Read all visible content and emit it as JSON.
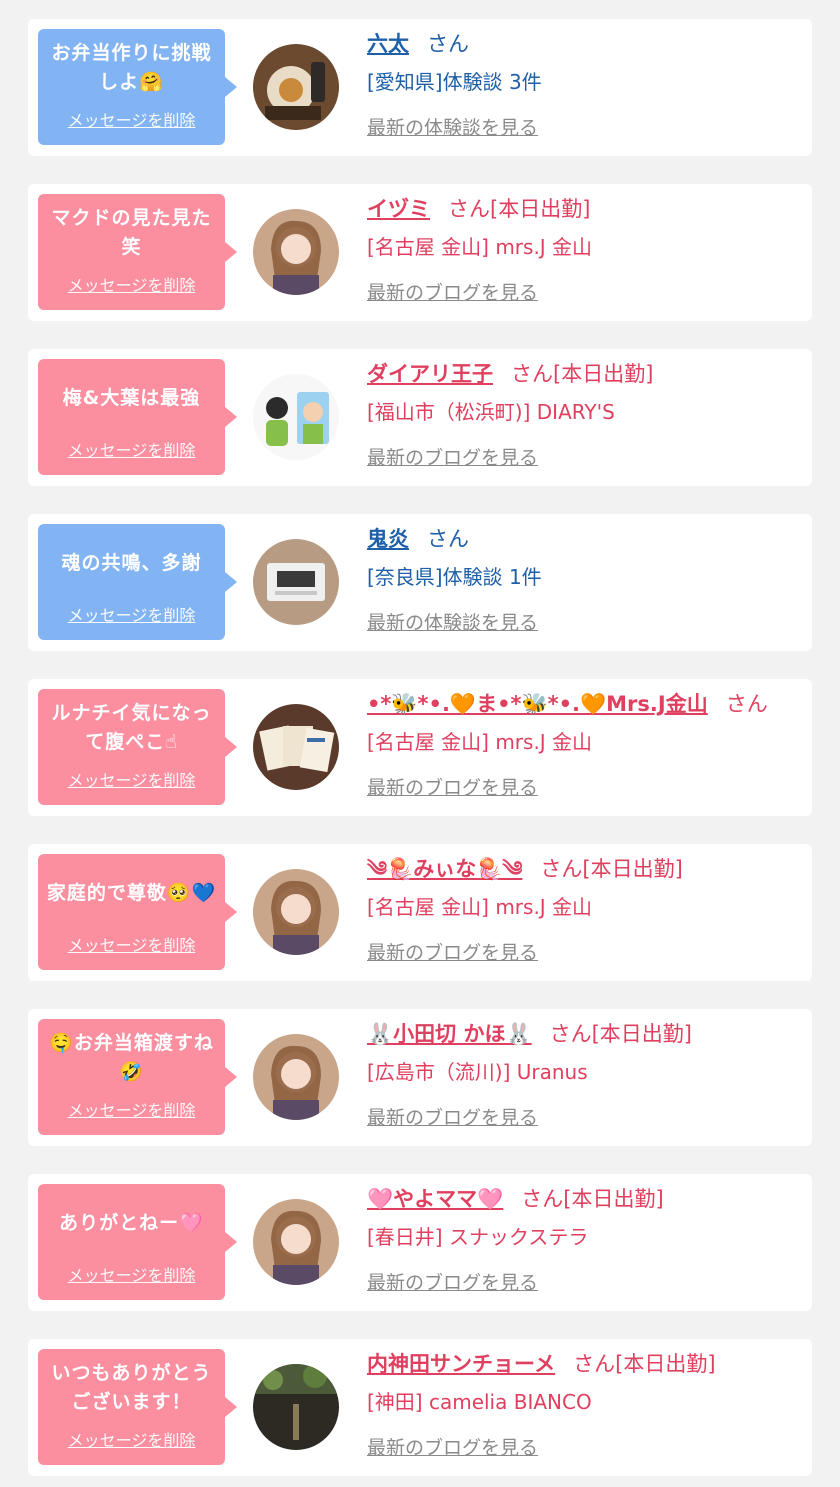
{
  "colors": {
    "blue_bubble": "#82b4f3",
    "pink_bubble": "#fb8e9f",
    "blue_text": "#1e5fa8",
    "pink_text": "#e0405f",
    "link_gray": "#8a8a8a"
  },
  "items": [
    {
      "theme": "blue",
      "message": "お弁当作りに挑戦しよ🤗",
      "delete_label": "メッセージを削除",
      "name": "六太",
      "suffix": "さん",
      "shop": "[愛知県]体験談 3件",
      "latest_link": "最新の体験談を見る",
      "avatar_icon": "food-photo-icon"
    },
    {
      "theme": "pink",
      "message": "マクドの見た見た笑",
      "delete_label": "メッセージを削除",
      "name": "イヅミ",
      "suffix": "さん[本日出勤]",
      "shop": "[名古屋 金山] mrs.J 金山",
      "latest_link": "最新のブログを見る",
      "avatar_icon": "profile-photo-icon"
    },
    {
      "theme": "pink",
      "message": "梅&大葉は最強",
      "delete_label": "メッセージを削除",
      "name": "ダイアリ王子",
      "suffix": "さん[本日出勤]",
      "shop": "[福山市（松浜町)] DIARY'S",
      "latest_link": "最新のブログを見る",
      "avatar_icon": "illustration-icon"
    },
    {
      "theme": "blue",
      "message": "魂の共鳴、多謝",
      "delete_label": "メッセージを削除",
      "name": "鬼炎",
      "suffix": "さん",
      "shop": "[奈良県]体験談 1件",
      "latest_link": "最新の体験談を見る",
      "avatar_icon": "clock-photo-icon"
    },
    {
      "theme": "pink",
      "message": "ルナチイ気になって腹ぺこ☝",
      "delete_label": "メッセージを削除",
      "name": "•*🐝*•.🧡ま•*🐝*•.🧡Mrs.J金山",
      "suffix": "さん",
      "shop": "[名古屋 金山] mrs.J 金山",
      "latest_link": "最新のブログを見る",
      "avatar_icon": "cards-photo-icon"
    },
    {
      "theme": "pink",
      "message": "家庭的で尊敬🥺💙",
      "delete_label": "メッセージを削除",
      "name": "༄🪼みぃな🪼༄",
      "suffix": "さん[本日出勤]",
      "shop": "[名古屋 金山] mrs.J 金山",
      "latest_link": "最新のブログを見る",
      "avatar_icon": "profile-photo-icon"
    },
    {
      "theme": "pink",
      "message": "🤤お弁当箱渡すね🤣",
      "delete_label": "メッセージを削除",
      "name": "🐰小田切 かほ🐰",
      "suffix": "さん[本日出勤]",
      "shop": "[広島市（流川)] Uranus",
      "latest_link": "最新のブログを見る",
      "avatar_icon": "profile-photo-icon"
    },
    {
      "theme": "pink",
      "message": "ありがとねー🩷",
      "delete_label": "メッセージを削除",
      "name": "🩷やよママ🩷",
      "suffix": "さん[本日出勤]",
      "shop": "[春日井] スナックステラ",
      "latest_link": "最新のブログを見る",
      "avatar_icon": "profile-photo-icon"
    },
    {
      "theme": "pink",
      "message": "いつもありがとうございます！",
      "delete_label": "メッセージを削除",
      "name": "内神田サンチョーメ",
      "suffix": "さん[本日出勤]",
      "shop": "[神田] camelia BIANCO",
      "latest_link": "最新のブログを見る",
      "avatar_icon": "bar-photo-icon"
    }
  ]
}
